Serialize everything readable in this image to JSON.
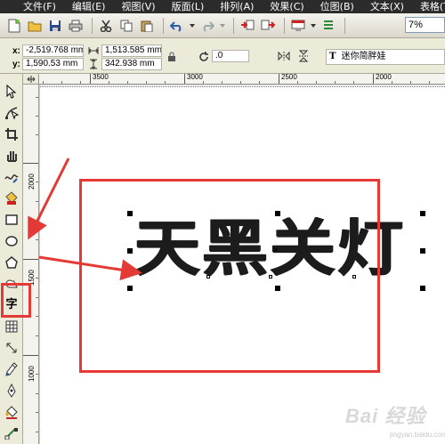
{
  "menubar": {
    "items": [
      "文件(F)",
      "编辑(E)",
      "视图(V)",
      "版面(L)",
      "排列(A)",
      "效果(C)",
      "位图(B)",
      "文本(X)",
      "表格(T)"
    ]
  },
  "toolbar": {
    "zoom": "7%",
    "icons": [
      "new-icon",
      "open-icon",
      "save-icon",
      "print-icon",
      "cut-icon",
      "copy-icon",
      "paste-icon",
      "undo-icon",
      "redo-icon",
      "import-icon",
      "export-icon",
      "app-launcher-icon",
      "options-icon"
    ]
  },
  "propbar": {
    "x_label": "x:",
    "y_label": "y:",
    "x_value": "-2,519.768 mm",
    "y_value": "1,590.53 mm",
    "width_value": "1,513.585 mm",
    "height_value": "342.938 mm",
    "rotation_value": ".0",
    "font_name": "迷你简胖娃"
  },
  "ruler": {
    "h_labels": [
      "3500",
      "3000",
      "2500",
      "2000"
    ],
    "v_labels": [
      "2000",
      "1500",
      "1000"
    ]
  },
  "canvas": {
    "text": "天黑关灯"
  },
  "watermark": {
    "brand": "Bai 经验",
    "url": "jingyan.baidu.com"
  },
  "colors": {
    "annotation": "#e53935",
    "menubar_bg": "#2b2b2b",
    "canvas_bg": "#ffffff"
  }
}
